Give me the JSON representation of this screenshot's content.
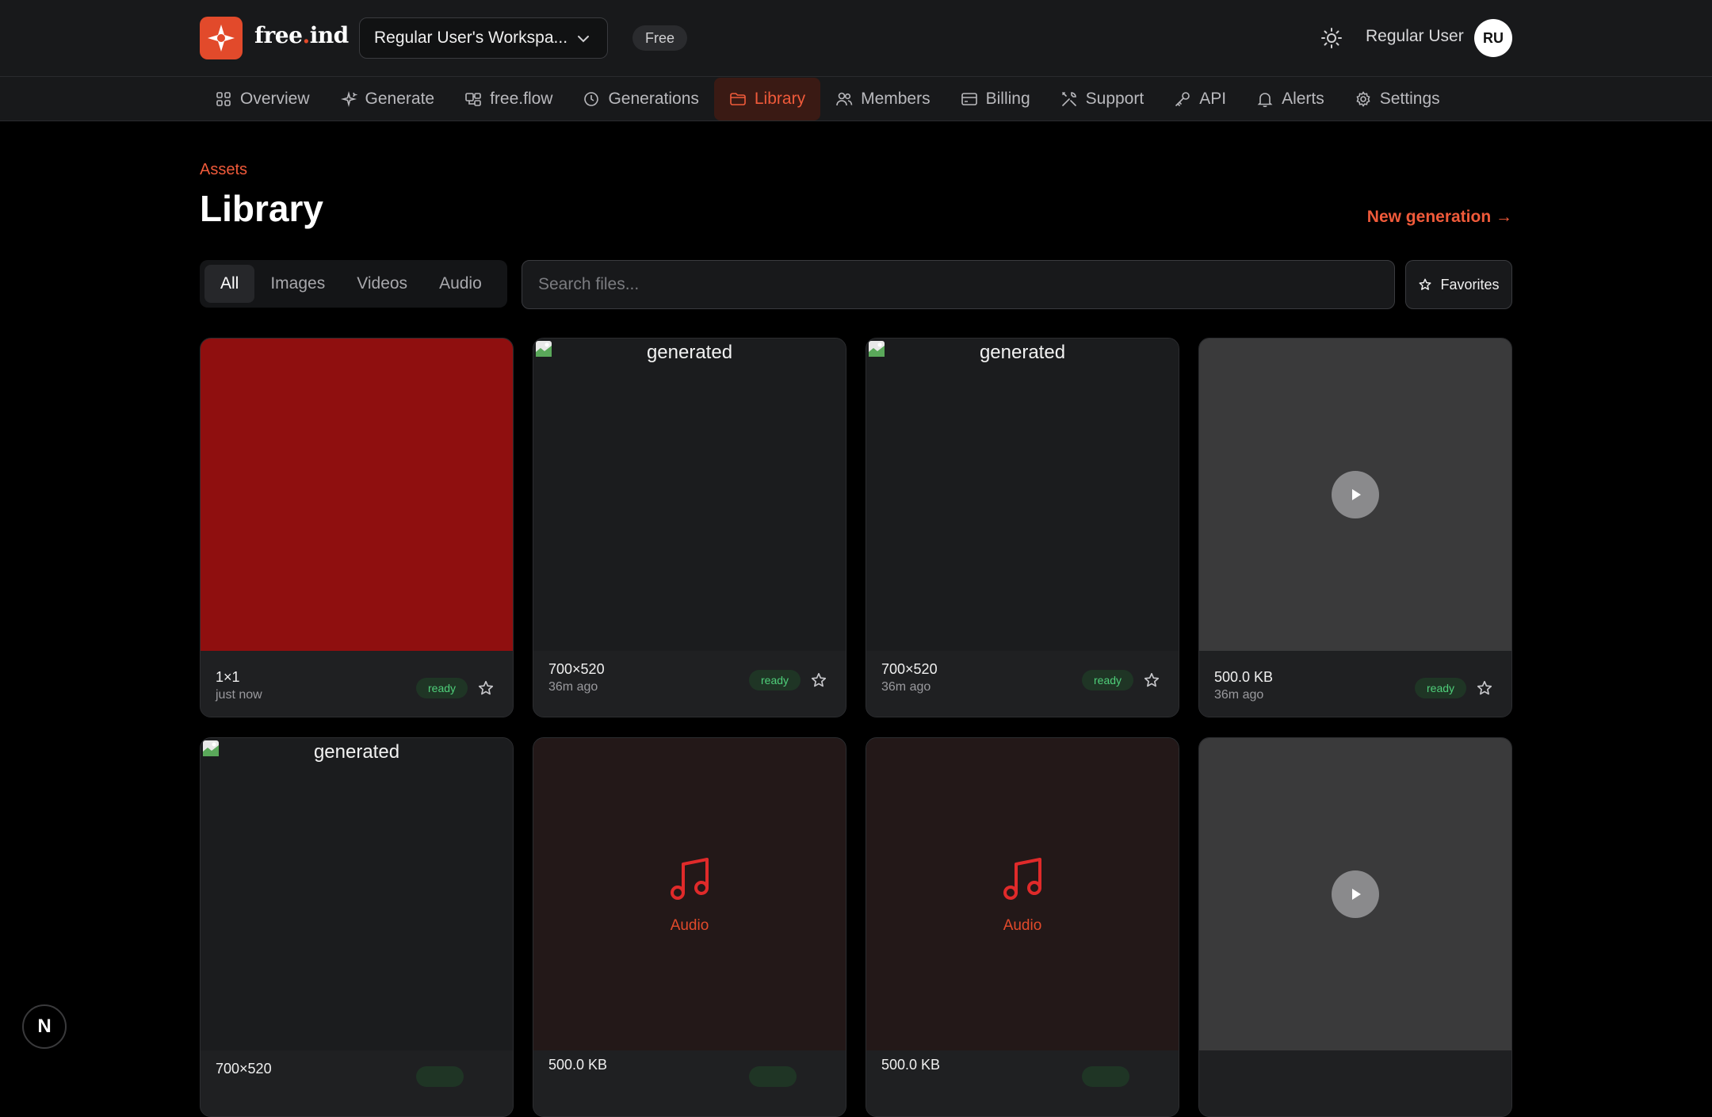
{
  "brand": {
    "name_main": "free",
    "name_dot": ".",
    "name_end": "ind"
  },
  "workspace": {
    "label": "Regular User's Workspa..."
  },
  "plan_badge": "Free",
  "user": {
    "name": "Regular User",
    "initials": "RU"
  },
  "nav": [
    {
      "label": "Overview",
      "icon": "grid-icon"
    },
    {
      "label": "Generate",
      "icon": "sparkle-icon"
    },
    {
      "label": "free.flow",
      "icon": "flow-icon"
    },
    {
      "label": "Generations",
      "icon": "clock-icon"
    },
    {
      "label": "Library",
      "icon": "folder-icon",
      "active": true
    },
    {
      "label": "Members",
      "icon": "users-icon"
    },
    {
      "label": "Billing",
      "icon": "card-icon"
    },
    {
      "label": "Support",
      "icon": "tools-icon"
    },
    {
      "label": "API",
      "icon": "key-icon"
    },
    {
      "label": "Alerts",
      "icon": "bell-icon"
    },
    {
      "label": "Settings",
      "icon": "gear-icon"
    }
  ],
  "page": {
    "breadcrumb": "Assets",
    "title": "Library",
    "new_generation": "New generation →"
  },
  "filters": {
    "tabs": [
      "All",
      "Images",
      "Videos",
      "Audio"
    ],
    "active": "All"
  },
  "search": {
    "placeholder": "Search files...",
    "value": ""
  },
  "favorites_label": "Favorites",
  "colors": {
    "accent": "#e24a2b",
    "ready": "#4fcf7a",
    "swatch_red": "#8f0f0f"
  },
  "cards": [
    {
      "kind": "swatch",
      "meta1": "1×1",
      "meta2": "just now",
      "status": "ready"
    },
    {
      "kind": "image",
      "alt": "generated",
      "meta1": "700×520",
      "meta2": "36m ago",
      "status": "ready"
    },
    {
      "kind": "image",
      "alt": "generated",
      "meta1": "700×520",
      "meta2": "36m ago",
      "status": "ready"
    },
    {
      "kind": "video",
      "meta1": "500.0 KB",
      "meta2": "36m ago",
      "status": "ready"
    },
    {
      "kind": "image",
      "alt": "generated",
      "meta1": "700×520"
    },
    {
      "kind": "audio",
      "label": "Audio",
      "meta1": "500.0 KB"
    },
    {
      "kind": "audio",
      "label": "Audio",
      "meta1": "500.0 KB"
    },
    {
      "kind": "video"
    }
  ],
  "dev_badge": "N"
}
